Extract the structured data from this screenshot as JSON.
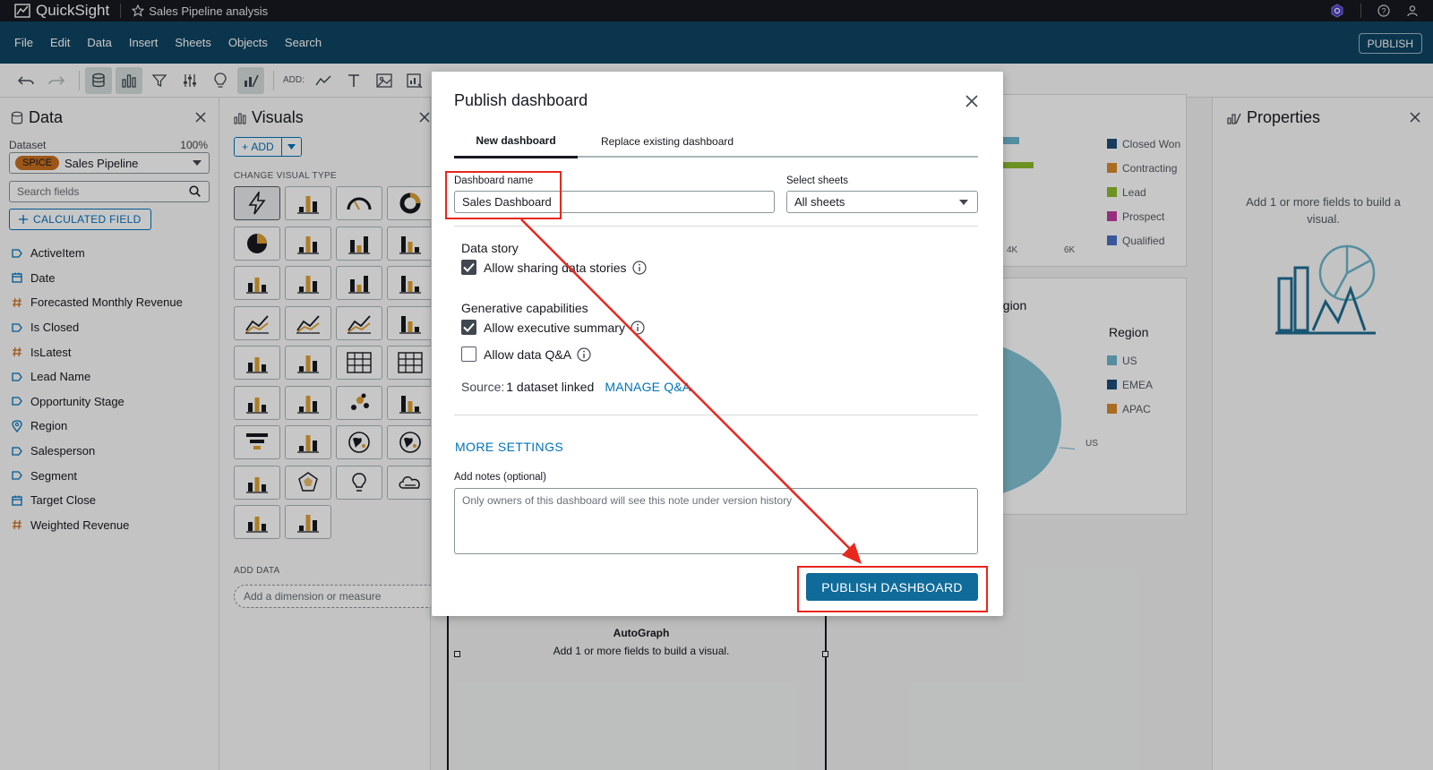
{
  "app": {
    "name": "QuickSight",
    "analysis_title": "Sales Pipeline analysis"
  },
  "menu": {
    "items": [
      "File",
      "Edit",
      "Data",
      "Insert",
      "Sheets",
      "Objects",
      "Search"
    ],
    "publish_label": "PUBLISH"
  },
  "toolbar": {
    "add_label": "ADD:"
  },
  "data_panel": {
    "title": "Data",
    "dataset_label": "Dataset",
    "dataset_percent": "100%",
    "spice_badge": "SPICE",
    "dataset_name": "Sales Pipeline",
    "search_placeholder": "Search fields",
    "calculated_field_label": "CALCULATED FIELD",
    "fields": [
      {
        "name": "ActiveItem",
        "type": "dimension"
      },
      {
        "name": "Date",
        "type": "date"
      },
      {
        "name": "Forecasted Monthly Revenue",
        "type": "measure"
      },
      {
        "name": "Is Closed",
        "type": "dimension"
      },
      {
        "name": "IsLatest",
        "type": "measure"
      },
      {
        "name": "Lead Name",
        "type": "dimension"
      },
      {
        "name": "Opportunity Stage",
        "type": "dimension"
      },
      {
        "name": "Region",
        "type": "geo"
      },
      {
        "name": "Salesperson",
        "type": "dimension"
      },
      {
        "name": "Segment",
        "type": "dimension"
      },
      {
        "name": "Target Close",
        "type": "date"
      },
      {
        "name": "Weighted Revenue",
        "type": "measure"
      }
    ]
  },
  "visuals_panel": {
    "title": "Visuals",
    "add_label": "ADD",
    "change_visual_type_label": "CHANGE VISUAL TYPE",
    "add_data_label": "ADD DATA",
    "add_dimension_placeholder": "Add a dimension or measure"
  },
  "canvas": {
    "stage_legend": [
      {
        "label": "Closed Won",
        "color": "#1f4e79"
      },
      {
        "label": "Contracting",
        "color": "#d98b2b"
      },
      {
        "label": "Lead",
        "color": "#8cbb2c"
      },
      {
        "label": "Prospect",
        "color": "#c33aa1"
      },
      {
        "label": "Qualified",
        "color": "#4a6fc4"
      }
    ],
    "axis_ticks": [
      "4K",
      "6K"
    ],
    "region_title_partial": "egion",
    "region_legend_title": "Region",
    "region_legend": [
      {
        "label": "US",
        "color": "#6cb7cc"
      },
      {
        "label": "EMEA",
        "color": "#1f4e79"
      },
      {
        "label": "APAC",
        "color": "#d98b2b"
      }
    ],
    "pie_label": "US",
    "autograph_title": "AutoGraph",
    "autograph_message": "Add 1 or more fields to build a visual."
  },
  "properties_panel": {
    "title": "Properties",
    "message": "Add 1 or more fields to build a visual."
  },
  "modal": {
    "title": "Publish dashboard",
    "tabs": [
      "New dashboard",
      "Replace existing dashboard"
    ],
    "dashboard_name_label": "Dashboard name",
    "dashboard_name_value": "Sales Dashboard",
    "select_sheets_label": "Select sheets",
    "select_sheets_value": "All sheets",
    "data_story_title": "Data story",
    "allow_sharing_label": "Allow sharing data stories",
    "allow_sharing_checked": true,
    "generative_title": "Generative capabilities",
    "exec_summary_label": "Allow executive summary",
    "exec_summary_checked": true,
    "data_qa_label": "Allow data Q&A",
    "data_qa_checked": false,
    "source_label": "Source:",
    "source_value": "1 dataset linked",
    "manage_qa_label": "MANAGE Q&A",
    "more_settings_label": "MORE SETTINGS",
    "notes_label": "Add notes (optional)",
    "notes_placeholder": "Only owners of this dashboard will see this note under version history",
    "publish_button_label": "PUBLISH DASHBOARD"
  },
  "colors": {
    "brand_bar": "#0f4462",
    "primary_button": "#0f6b99",
    "link": "#0073bb",
    "annotation": "#e8271d"
  }
}
